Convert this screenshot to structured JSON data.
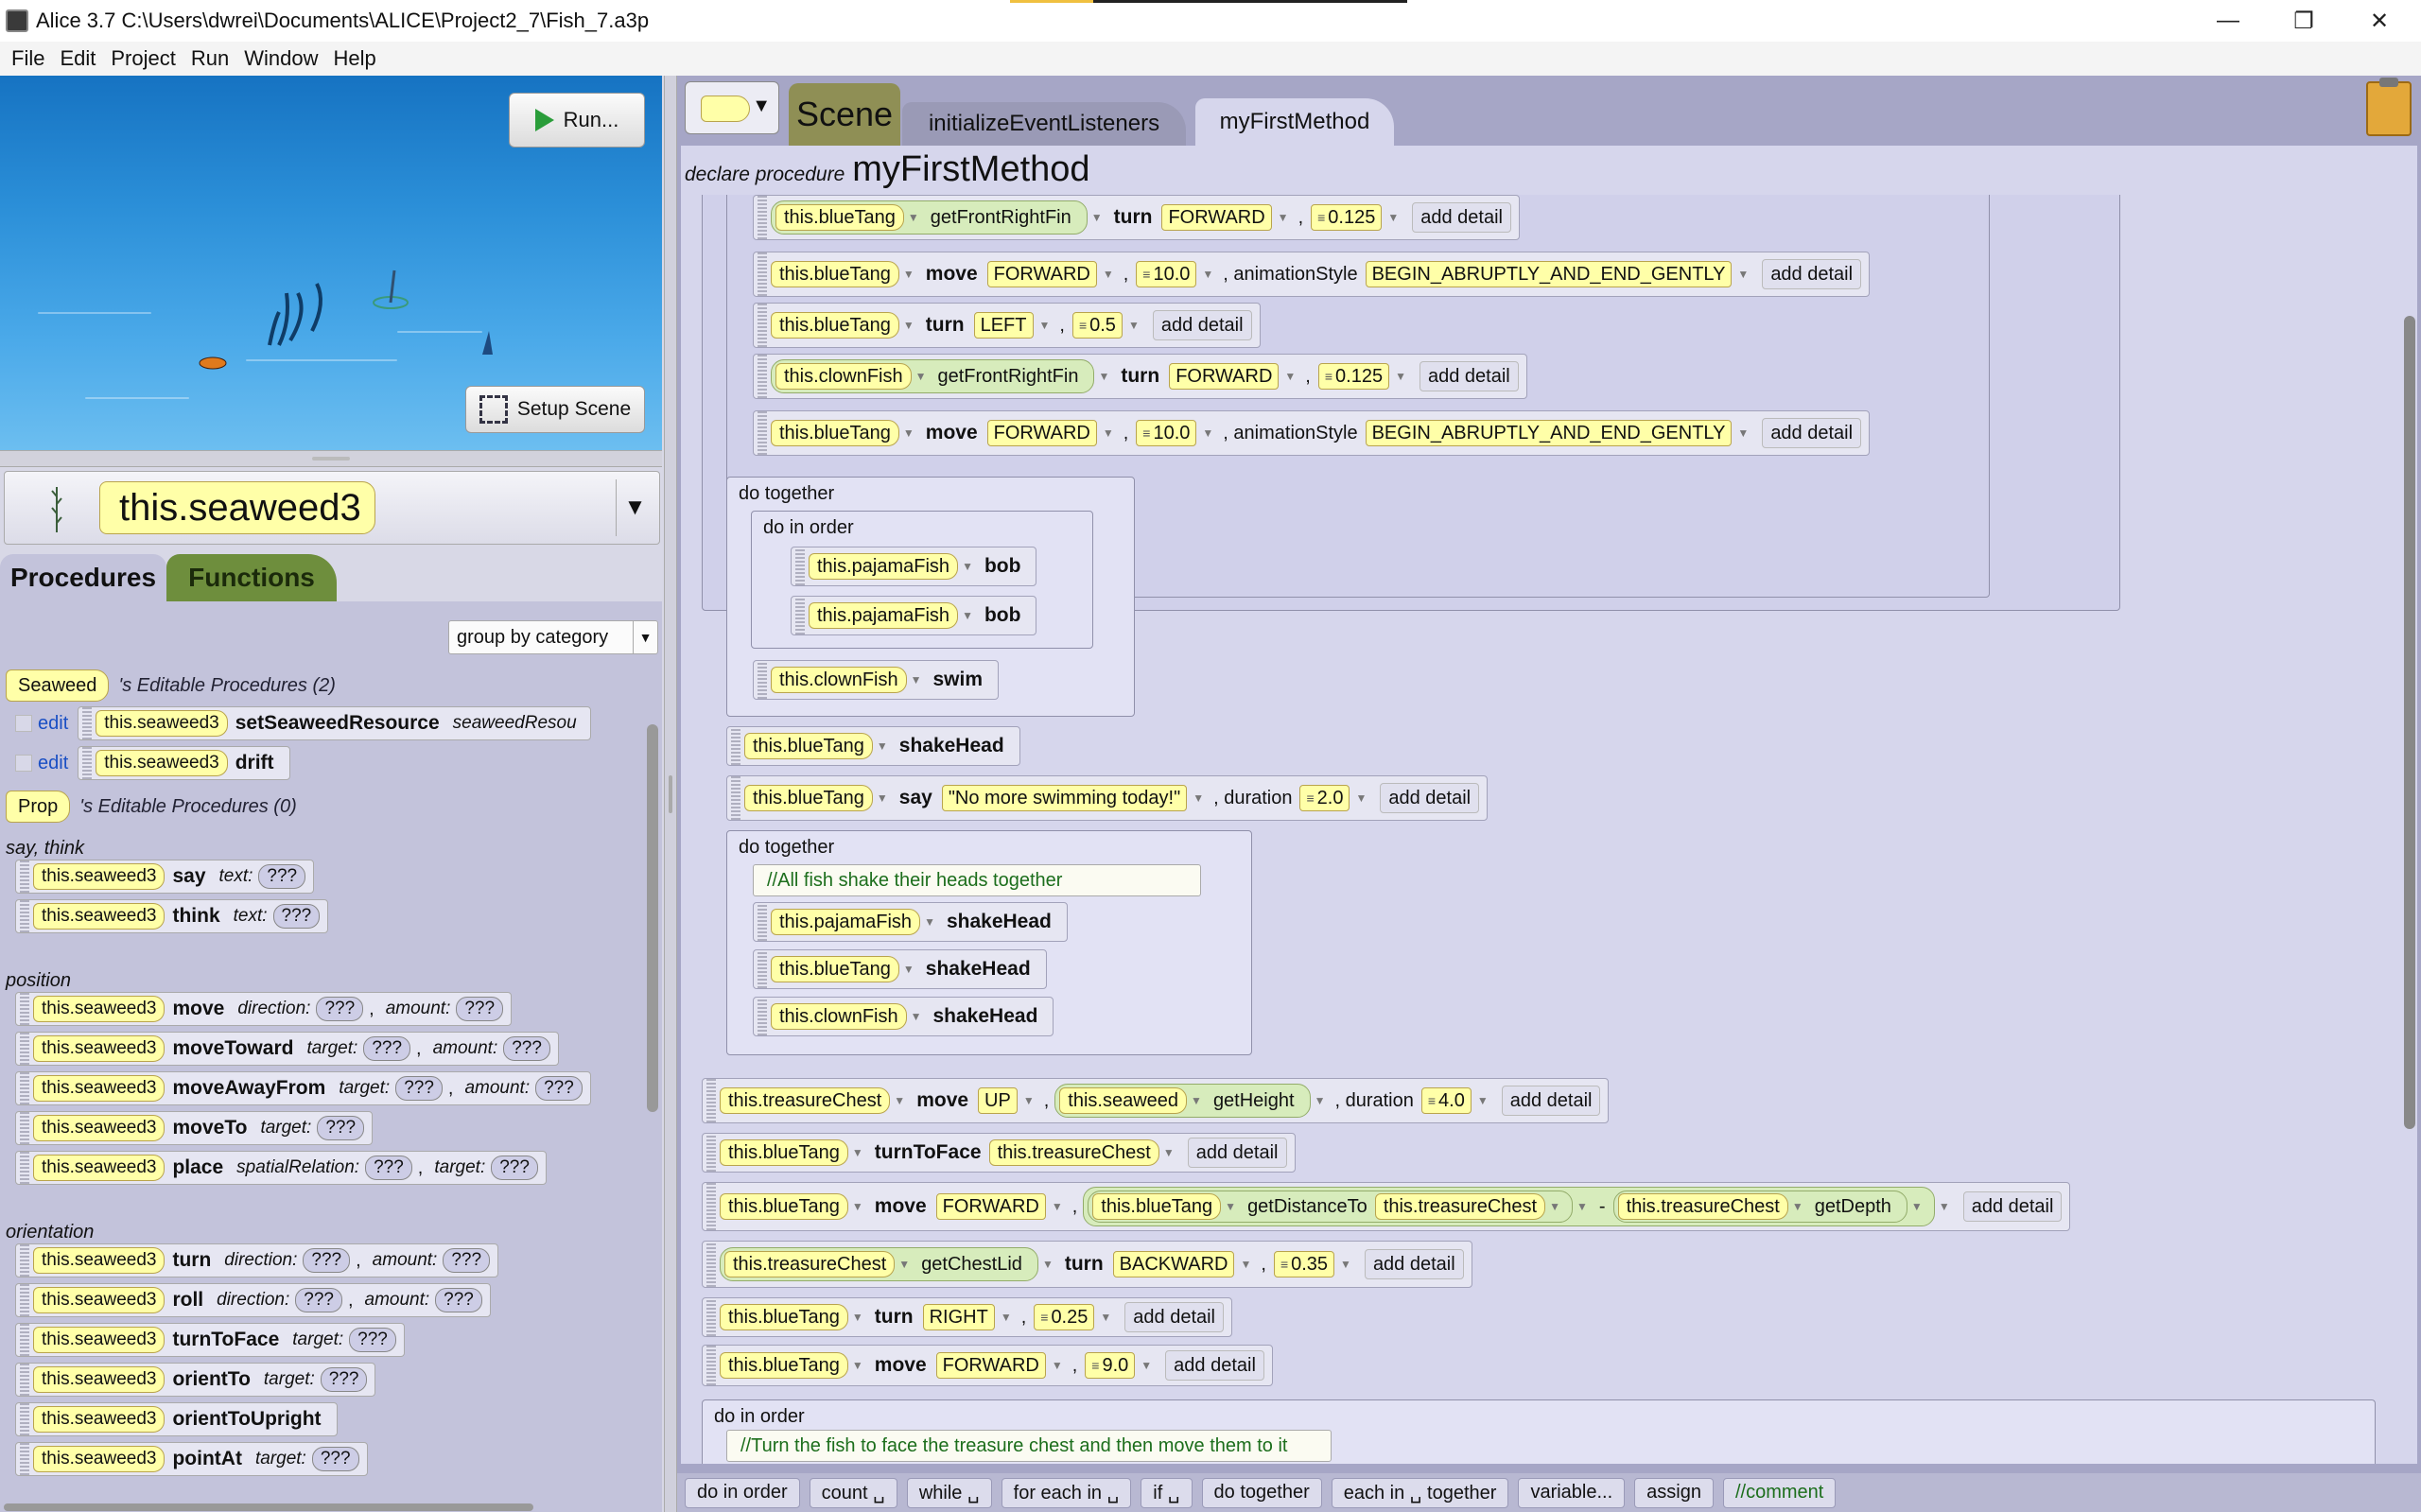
{
  "window": {
    "title": "Alice 3.7 C:\\Users\\dwrei\\Documents\\ALICE\\Project2_7\\Fish_7.a3p",
    "minimize": "—",
    "restore": "❐",
    "close": "✕"
  },
  "menu": [
    "File",
    "Edit",
    "Project",
    "Run",
    "Window",
    "Help"
  ],
  "scene": {
    "run_label": "Run...",
    "setup_label": "Setup Scene"
  },
  "selector": {
    "value": "this.seaweed3"
  },
  "left_tabs": {
    "procedures": "Procedures",
    "functions": "Functions"
  },
  "group_by": "group by category",
  "editable": {
    "seaweed": {
      "type": "Seaweed",
      "label": "'s Editable Procedures (2)"
    },
    "edit": "edit",
    "items": [
      {
        "obj": "this.seaweed3",
        "name": "setSeaweedResource",
        "param": "seaweedResou"
      },
      {
        "obj": "this.seaweed3",
        "name": "drift"
      }
    ],
    "prop": {
      "type": "Prop",
      "label": "'s Editable Procedures (0)"
    }
  },
  "categories": {
    "saythink": "say, think",
    "position": "position",
    "orientation": "orientation"
  },
  "procs": {
    "obj": "this.seaweed3",
    "q": "???",
    "comma": ",",
    "say": {
      "name": "say",
      "p1": "text:"
    },
    "think": {
      "name": "think",
      "p1": "text:"
    },
    "move": {
      "name": "move",
      "p1": "direction:",
      "p2": "amount:"
    },
    "moveToward": {
      "name": "moveToward",
      "p1": "target:",
      "p2": "amount:"
    },
    "moveAwayFrom": {
      "name": "moveAwayFrom",
      "p1": "target:",
      "p2": "amount:"
    },
    "moveTo": {
      "name": "moveTo",
      "p1": "target:"
    },
    "place": {
      "name": "place",
      "p1": "spatialRelation:",
      "p2": "target:"
    },
    "turn": {
      "name": "turn",
      "p1": "direction:",
      "p2": "amount:"
    },
    "roll": {
      "name": "roll",
      "p1": "direction:",
      "p2": "amount:"
    },
    "turnToFace": {
      "name": "turnToFace",
      "p1": "target:"
    },
    "orientTo": {
      "name": "orientTo",
      "p1": "target:"
    },
    "orientToUpright": {
      "name": "orientToUpright"
    },
    "pointAt": {
      "name": "pointAt",
      "p1": "target:"
    }
  },
  "editor_tabs": {
    "scene": "Scene",
    "init": "initializeEventListeners",
    "method": "myFirstMethod"
  },
  "declare": {
    "label": "declare procedure",
    "name": "myFirstMethod"
  },
  "code": {
    "add_detail": "add detail",
    "comma": ",",
    "s1": {
      "obj": "this.blueTang",
      "fn": "getFrontRightFin",
      "verb": "turn",
      "dir": "FORWARD",
      "amt": "0.125"
    },
    "s2": {
      "obj": "this.blueTang",
      "verb": "move",
      "dir": "FORWARD",
      "amt": "10.0",
      "k": ", animationStyle",
      "style": "BEGIN_ABRUPTLY_AND_END_GENTLY"
    },
    "s3": {
      "obj": "this.blueTang",
      "verb": "turn",
      "dir": "LEFT",
      "amt": "0.5"
    },
    "s4": {
      "obj": "this.clownFish",
      "fn": "getFrontRightFin",
      "verb": "turn",
      "dir": "FORWARD",
      "amt": "0.125"
    },
    "s5": {
      "obj": "this.blueTang",
      "verb": "move",
      "dir": "FORWARD",
      "amt": "10.0",
      "k": ", animationStyle",
      "style": "BEGIN_ABRUPTLY_AND_END_GENTLY"
    },
    "dotogether": "do together",
    "doinorder": "do in order",
    "dt1": {
      "a": {
        "obj": "this.pajamaFish",
        "verb": "bob"
      },
      "b": {
        "obj": "this.pajamaFish",
        "verb": "bob"
      },
      "c": {
        "obj": "this.clownFish",
        "verb": "swim"
      }
    },
    "s6": {
      "obj": "this.blueTang",
      "verb": "shakeHead"
    },
    "s7": {
      "obj": "this.blueTang",
      "verb": "say",
      "text": "\"No more swimming today!\"",
      "k": ", duration",
      "dur": "2.0"
    },
    "dt2": {
      "comment": "//All fish shake their heads together",
      "a": {
        "obj": "this.pajamaFish",
        "verb": "shakeHead"
      },
      "b": {
        "obj": "this.blueTang",
        "verb": "shakeHead"
      },
      "c": {
        "obj": "this.clownFish",
        "verb": "shakeHead"
      }
    },
    "s8": {
      "obj": "this.treasureChest",
      "verb": "move",
      "dir": "UP",
      "fnobj": "this.seaweed",
      "fn": "getHeight",
      "k": ", duration",
      "dur": "4.0"
    },
    "s9": {
      "obj": "this.blueTang",
      "verb": "turnToFace",
      "target": "this.treasureChest"
    },
    "s10": {
      "obj": "this.blueTang",
      "verb": "move",
      "dir": "FORWARD",
      "fnobj": "this.blueTang",
      "fn": "getDistanceTo",
      "arg": "this.treasureChest",
      "minus": "-",
      "fnobj2": "this.treasureChest",
      "fn2": "getDepth"
    },
    "s11": {
      "obj": "this.treasureChest",
      "fn": "getChestLid",
      "verb": "turn",
      "dir": "BACKWARD",
      "amt": "0.35"
    },
    "s12": {
      "obj": "this.blueTang",
      "verb": "turn",
      "dir": "RIGHT",
      "amt": "0.25"
    },
    "s13": {
      "obj": "this.blueTang",
      "verb": "move",
      "dir": "FORWARD",
      "amt": "9.0"
    },
    "dio_comment": "//Turn the fish to face the treasure chest and then move them to it"
  },
  "templates": [
    "do in order",
    "count ␣",
    "while ␣",
    "for each in ␣",
    "if ␣",
    "do together",
    "each in ␣ together",
    "variable...",
    "assign",
    "//comment"
  ],
  "colors": {
    "object_chip": "#ffffa8",
    "function_bg": "#d7ecbc",
    "editor_bg": "#d6d6ec",
    "comment_text": "#1c6e1c",
    "scene_tab": "#8f8f55",
    "functions_tab": "#6e8e3d"
  }
}
